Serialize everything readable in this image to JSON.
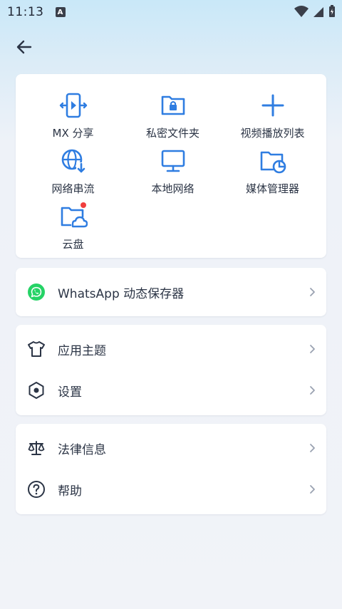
{
  "status_bar": {
    "time": "11:13",
    "notification_letter": "A"
  },
  "header": {
    "back_icon": "arrow-left-icon"
  },
  "colors": {
    "accent": "#2f7de1",
    "whatsapp": "#25d366",
    "text": "#2b3445",
    "badge": "#f03e3e",
    "chevron": "#9aa2b1"
  },
  "grid": [
    {
      "label": "MX 分享",
      "icon": "share-transfer-icon"
    },
    {
      "label": "私密文件夹",
      "icon": "locked-folder-icon"
    },
    {
      "label": "视频播放列表",
      "icon": "plus-icon"
    },
    {
      "label": "网络串流",
      "icon": "globe-download-icon"
    },
    {
      "label": "本地网络",
      "icon": "monitor-icon"
    },
    {
      "label": "媒体管理器",
      "icon": "folder-chart-icon"
    },
    {
      "label": "云盘",
      "icon": "cloud-folder-icon",
      "badge": true
    }
  ],
  "whatsapp": {
    "label": "WhatsApp 动态保存器",
    "icon": "whatsapp-icon"
  },
  "settings_group": [
    {
      "label": "应用主题",
      "icon": "tshirt-icon"
    },
    {
      "label": "设置",
      "icon": "hexagon-settings-icon"
    }
  ],
  "info_group": [
    {
      "label": "法律信息",
      "icon": "scale-icon"
    },
    {
      "label": "帮助",
      "icon": "help-circle-icon"
    }
  ]
}
